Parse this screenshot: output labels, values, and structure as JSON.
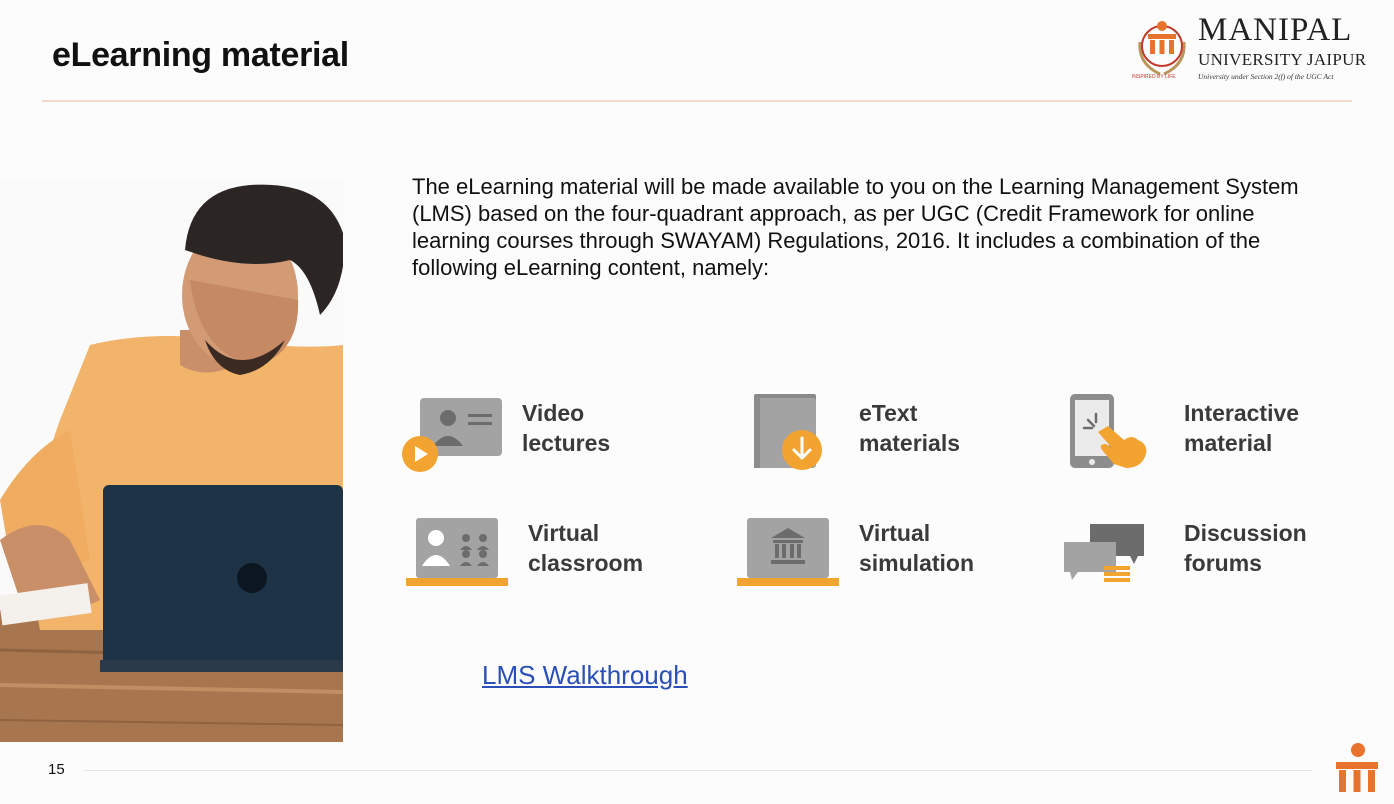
{
  "slide": {
    "title": "eLearning material",
    "page_number": "15"
  },
  "logo": {
    "name": "MANIPAL",
    "sub": "UNIVERSITY JAIPUR",
    "act": "University under Section 2(f) of the UGC Act",
    "inspired": "INSPIRED BY LIFE"
  },
  "intro": "The eLearning material will be made available to you on the Learning Management System (LMS) based on the four-quadrant approach, as per UGC (Credit Framework for online learning courses through SWAYAM) Regulations, 2016. It includes a combination of the following eLearning content, namely:",
  "features": [
    {
      "line1": "Video",
      "line2": "lectures",
      "icon": "video-lectures-icon"
    },
    {
      "line1": "eText",
      "line2": "materials",
      "icon": "etext-book-icon"
    },
    {
      "line1": "Interactive",
      "line2": "material",
      "icon": "interactive-touch-icon"
    },
    {
      "line1": "Virtual",
      "line2": "classroom",
      "icon": "virtual-classroom-icon"
    },
    {
      "line1": "Virtual",
      "line2": "simulation",
      "icon": "virtual-simulation-icon"
    },
    {
      "line1": "Discussion",
      "line2": "forums",
      "icon": "discussion-forums-icon"
    }
  ],
  "link": {
    "label": "LMS Walkthrough"
  },
  "colors": {
    "accent": "#f3a430",
    "icon_gray": "#a3a3a3",
    "icon_dark": "#6c6c6c",
    "link": "#2a4fb6"
  }
}
